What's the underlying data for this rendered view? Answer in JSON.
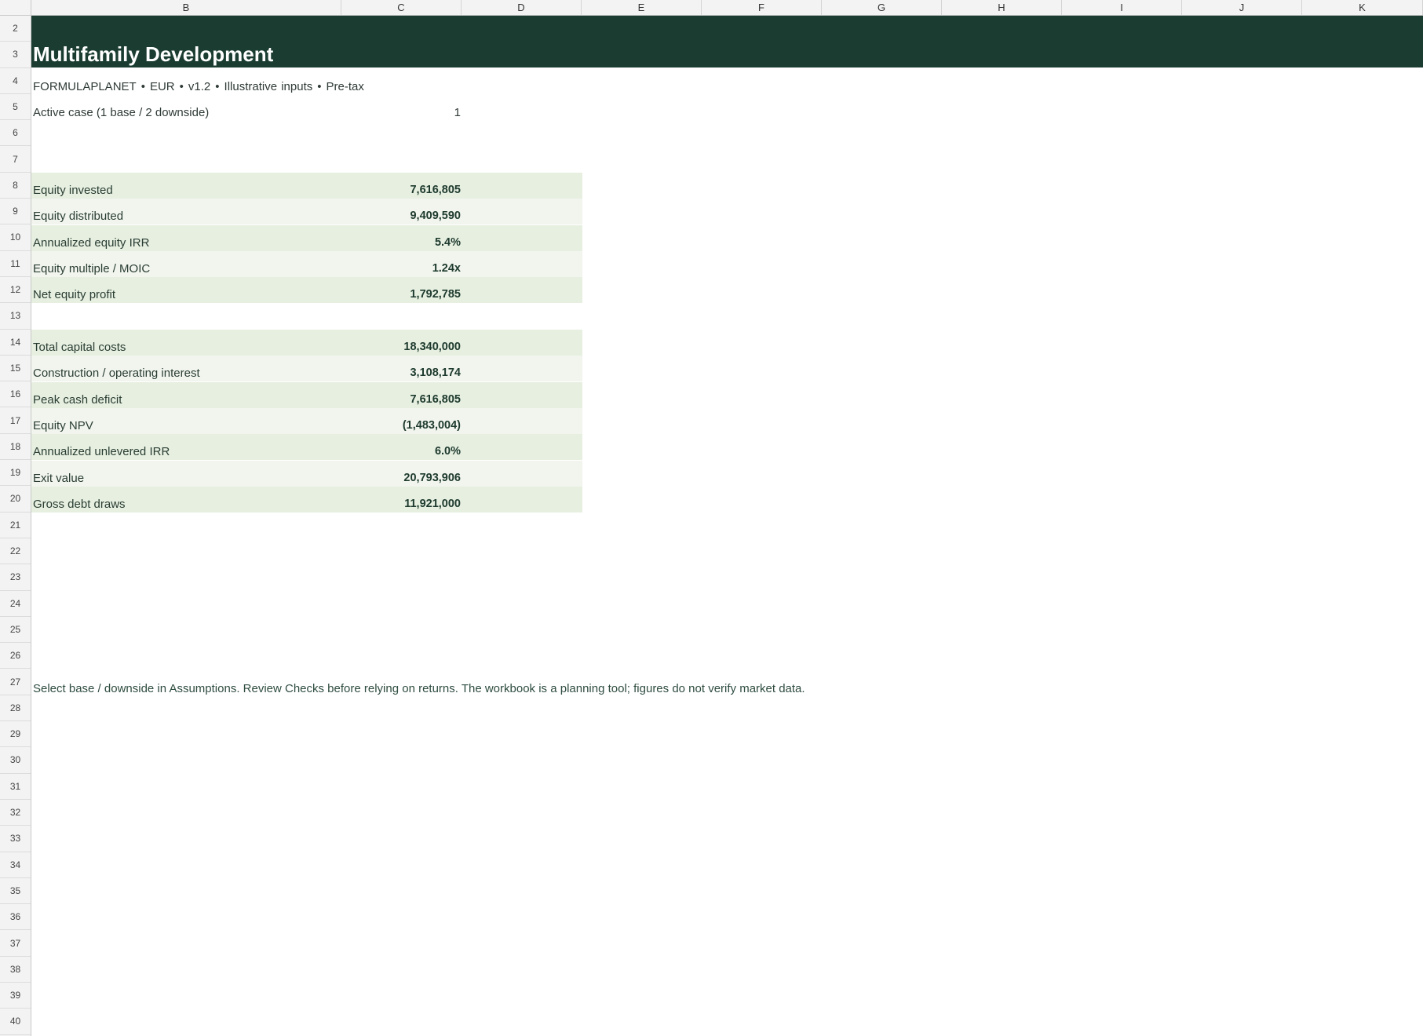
{
  "columns": [
    "B",
    "C",
    "D",
    "E",
    "F",
    "G",
    "H",
    "I",
    "J",
    "K"
  ],
  "rows": [
    "2",
    "3",
    "4",
    "5",
    "6",
    "7",
    "8",
    "9",
    "10",
    "11",
    "12",
    "13",
    "14",
    "15",
    "16",
    "17",
    "18",
    "19",
    "20",
    "21",
    "22",
    "23",
    "24",
    "25",
    "26",
    "27",
    "28",
    "29",
    "30",
    "31",
    "32",
    "33",
    "34",
    "35",
    "36",
    "37",
    "38",
    "39",
    "40"
  ],
  "header": {
    "title": "Multifamily Development",
    "subtitle_parts": [
      "FORMULAPLANET",
      "EUR",
      "v1.2",
      "Illustrative inputs",
      "Pre-tax"
    ],
    "separator": "•"
  },
  "active_case": {
    "label": "Active case (1 base / 2 downside)",
    "value": "1"
  },
  "returns_block": [
    {
      "label": "Equity invested",
      "value": "7,616,805"
    },
    {
      "label": "Equity distributed",
      "value": "9,409,590"
    },
    {
      "label": "Annualized equity IRR",
      "value": "5.4%"
    },
    {
      "label": "Equity multiple / MOIC",
      "value": "1.24x"
    },
    {
      "label": "Net equity profit",
      "value": "1,792,785"
    }
  ],
  "capital_block": [
    {
      "label": "Total capital costs",
      "value": "18,340,000"
    },
    {
      "label": "Construction / operating interest",
      "value": "3,108,174"
    },
    {
      "label": "Peak cash deficit",
      "value": "7,616,805"
    },
    {
      "label": "Equity NPV",
      "value": "(1,483,004)"
    },
    {
      "label": "Annualized unlevered IRR",
      "value": "6.0%"
    },
    {
      "label": "Exit value",
      "value": "20,793,906"
    },
    {
      "label": "Gross debt draws",
      "value": "11,921,000"
    }
  ],
  "note": "Select base / downside in Assumptions. Review Checks before relying on returns. The workbook is a planning tool; figures do not verify market data.",
  "colors": {
    "title_band": "#1b3d31",
    "kpi_band_a": "#e6efe0",
    "kpi_band_b": "#f1f5ee"
  }
}
